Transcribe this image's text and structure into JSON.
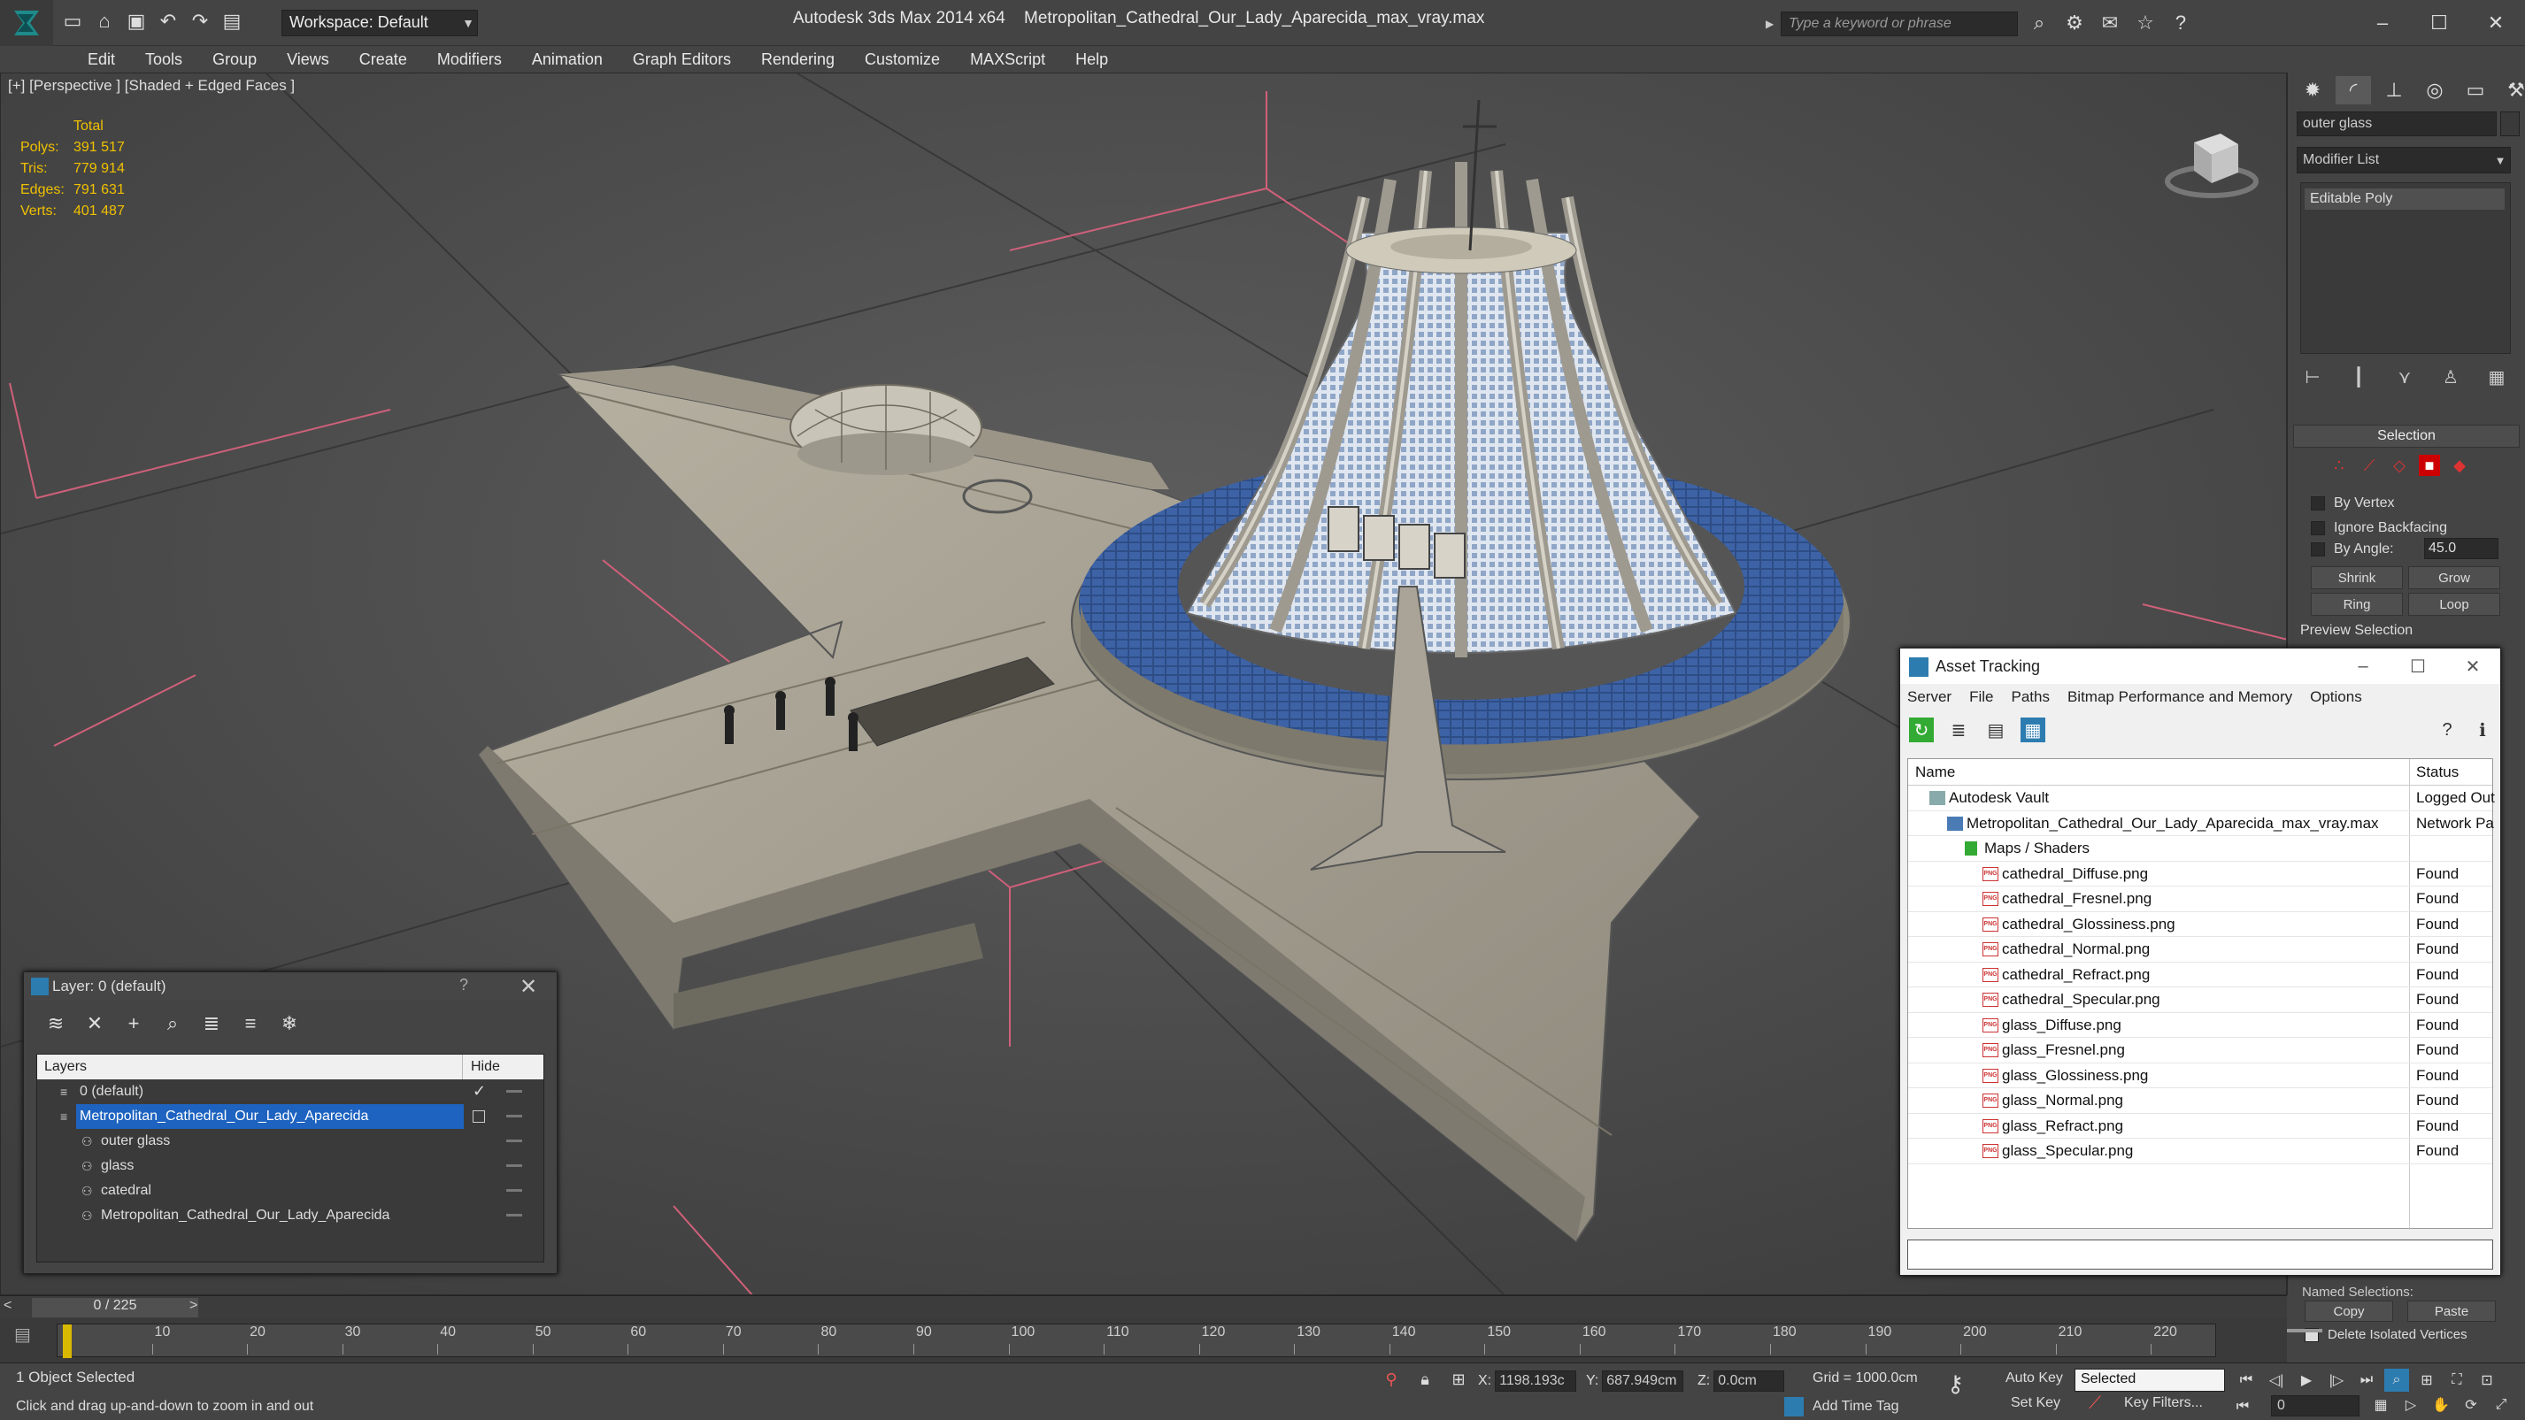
{
  "title_bar": {
    "workspace_label": "Workspace: Default",
    "app_title": "Autodesk 3ds Max  2014 x64",
    "file_title": "Metropolitan_Cathedral_Our_Lady_Aparecida_max_vray.max",
    "search_placeholder": "Type a keyword or phrase"
  },
  "menu": [
    "Edit",
    "Tools",
    "Group",
    "Views",
    "Create",
    "Modifiers",
    "Animation",
    "Graph Editors",
    "Rendering",
    "Customize",
    "MAXScript",
    "Help"
  ],
  "viewport": {
    "label": "[+] [Perspective ] [Shaded + Edged Faces ]",
    "stats": {
      "header": "Total",
      "rows": [
        {
          "label": "Polys:",
          "value": "391 517"
        },
        {
          "label": "Tris:",
          "value": "779 914"
        },
        {
          "label": "Edges:",
          "value": "791 631"
        },
        {
          "label": "Verts:",
          "value": "401 487"
        }
      ]
    }
  },
  "command_panel": {
    "object_name": "outer glass",
    "modifier_list": "Modifier List",
    "stack_item": "Editable Poly",
    "selection_title": "Selection",
    "by_vertex": "By Vertex",
    "ignore_backfacing": "Ignore Backfacing",
    "by_angle": "By Angle:",
    "by_angle_value": "45.0",
    "shrink": "Shrink",
    "grow": "Grow",
    "ring": "Ring",
    "loop": "Loop",
    "preview_selection": "Preview Selection",
    "named_selections": "Named Selections:",
    "copy": "Copy",
    "paste": "Paste",
    "delete_isolated": "Delete Isolated Vertices"
  },
  "layer_dialog": {
    "title": "Layer: 0 (default)",
    "help": "?",
    "col_layers": "Layers",
    "col_hide": "Hide",
    "rows": [
      {
        "name": "0 (default)",
        "indent": 1
      },
      {
        "name": "Metropolitan_Cathedral_Our_Lady_Aparecida",
        "indent": 1,
        "selected": true
      },
      {
        "name": "outer glass",
        "indent": 2
      },
      {
        "name": "glass",
        "indent": 2
      },
      {
        "name": "catedral",
        "indent": 2
      },
      {
        "name": "Metropolitan_Cathedral_Our_Lady_Aparecida",
        "indent": 2
      }
    ]
  },
  "asset_dialog": {
    "title": "Asset Tracking",
    "menu": [
      "Server",
      "File",
      "Paths",
      "Bitmap Performance and Memory",
      "Options"
    ],
    "col_name": "Name",
    "col_status": "Status",
    "rows": [
      {
        "name": "Autodesk Vault",
        "status": "Logged Out",
        "indent": 1,
        "icon": "vault"
      },
      {
        "name": "Metropolitan_Cathedral_Our_Lady_Aparecida_max_vray.max",
        "status": "Network Pa",
        "indent": 2,
        "icon": "max"
      },
      {
        "name": "Maps / Shaders",
        "status": "",
        "indent": 3,
        "icon": "folder"
      },
      {
        "name": "cathedral_Diffuse.png",
        "status": "Found",
        "indent": 4,
        "icon": "png"
      },
      {
        "name": "cathedral_Fresnel.png",
        "status": "Found",
        "indent": 4,
        "icon": "png"
      },
      {
        "name": "cathedral_Glossiness.png",
        "status": "Found",
        "indent": 4,
        "icon": "png"
      },
      {
        "name": "cathedral_Normal.png",
        "status": "Found",
        "indent": 4,
        "icon": "png"
      },
      {
        "name": "cathedral_Refract.png",
        "status": "Found",
        "indent": 4,
        "icon": "png"
      },
      {
        "name": "cathedral_Specular.png",
        "status": "Found",
        "indent": 4,
        "icon": "png"
      },
      {
        "name": "glass_Diffuse.png",
        "status": "Found",
        "indent": 4,
        "icon": "png"
      },
      {
        "name": "glass_Fresnel.png",
        "status": "Found",
        "indent": 4,
        "icon": "png"
      },
      {
        "name": "glass_Glossiness.png",
        "status": "Found",
        "indent": 4,
        "icon": "png"
      },
      {
        "name": "glass_Normal.png",
        "status": "Found",
        "indent": 4,
        "icon": "png"
      },
      {
        "name": "glass_Refract.png",
        "status": "Found",
        "indent": 4,
        "icon": "png"
      },
      {
        "name": "glass_Specular.png",
        "status": "Found",
        "indent": 4,
        "icon": "png"
      }
    ]
  },
  "timeline": {
    "frame_label": "0 / 225",
    "ticks": [
      "10",
      "20",
      "30",
      "40",
      "50",
      "60",
      "70",
      "80",
      "90",
      "100",
      "110",
      "120",
      "130",
      "140",
      "150",
      "160",
      "170",
      "180",
      "190",
      "200",
      "210",
      "220"
    ]
  },
  "status_bar": {
    "selection": "1 Object Selected",
    "prompt": "Click and drag up-and-down to zoom in and out",
    "x_label": "X:",
    "x_value": "1198.193c",
    "y_label": "Y:",
    "y_value": "687.949cm",
    "z_label": "Z:",
    "z_value": "0.0cm",
    "grid": "Grid = 1000.0cm",
    "add_time_tag": "Add Time Tag",
    "auto_key": "Auto Key",
    "set_key": "Set Key",
    "key_mode": "Selected",
    "key_filters": "Key Filters...",
    "frame": "0"
  },
  "icons": {
    "pink_axis_color": "#d0607a",
    "accent": "#2c7cb0"
  }
}
